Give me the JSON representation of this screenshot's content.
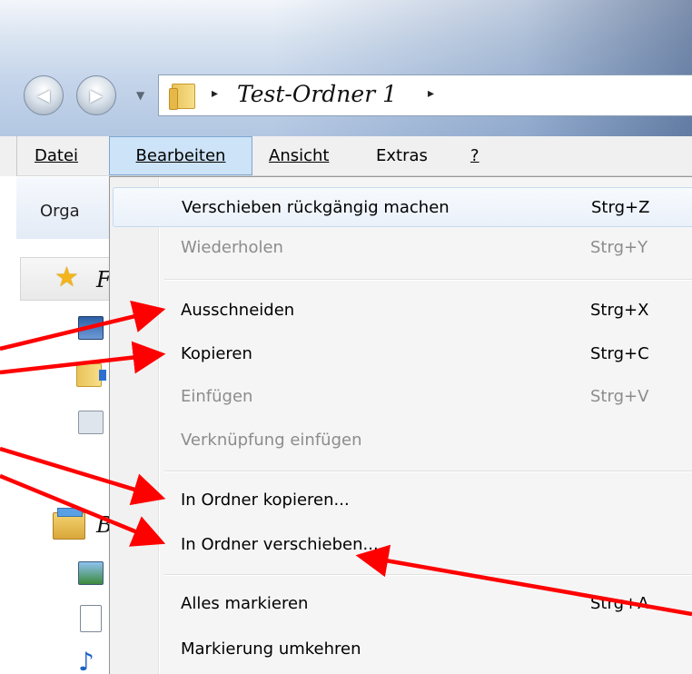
{
  "address_bar": {
    "nav_back": "◀",
    "nav_forward": "▶",
    "nav_dropdown": "▼",
    "crumb_separator": "▸",
    "crumb": "Test-Ordner 1"
  },
  "menubar": {
    "datei": "Datei",
    "bearbeiten": "Bearbeiten",
    "ansicht": "Ansicht",
    "extras": "Extras",
    "help": "?"
  },
  "toolbar": {
    "organize_truncated": "Orga"
  },
  "left_pane": {
    "favorites_truncated": "F",
    "libraries_truncated": "B",
    "icons": [
      "star-icon",
      "desktop-icon",
      "downloads-icon",
      "network-places-icon",
      "libraries-icon",
      "pictures-icon",
      "documents-icon",
      "music-icon"
    ]
  },
  "edit_menu": {
    "items": [
      {
        "label": "Verschieben rückgängig machen",
        "shortcut": "Strg+Z",
        "enabled": true
      },
      {
        "label": "Wiederholen",
        "shortcut": "Strg+Y",
        "enabled": false
      },
      {
        "label": "Ausschneiden",
        "shortcut": "Strg+X",
        "enabled": true
      },
      {
        "label": "Kopieren",
        "shortcut": "Strg+C",
        "enabled": true
      },
      {
        "label": "Einfügen",
        "shortcut": "Strg+V",
        "enabled": false
      },
      {
        "label": "Verknüpfung einfügen",
        "shortcut": "",
        "enabled": false
      },
      {
        "label": "In Ordner kopieren...",
        "shortcut": "",
        "enabled": true
      },
      {
        "label": "In Ordner verschieben...",
        "shortcut": "",
        "enabled": true
      },
      {
        "label": "Alles markieren",
        "shortcut": "Strg+A",
        "enabled": true
      },
      {
        "label": "Markierung umkehren",
        "shortcut": "",
        "enabled": true
      }
    ]
  },
  "colors": {
    "arrow": "#ff0000",
    "menu_highlight": "#cde3f7",
    "disabled_text": "#8c8c8c"
  }
}
